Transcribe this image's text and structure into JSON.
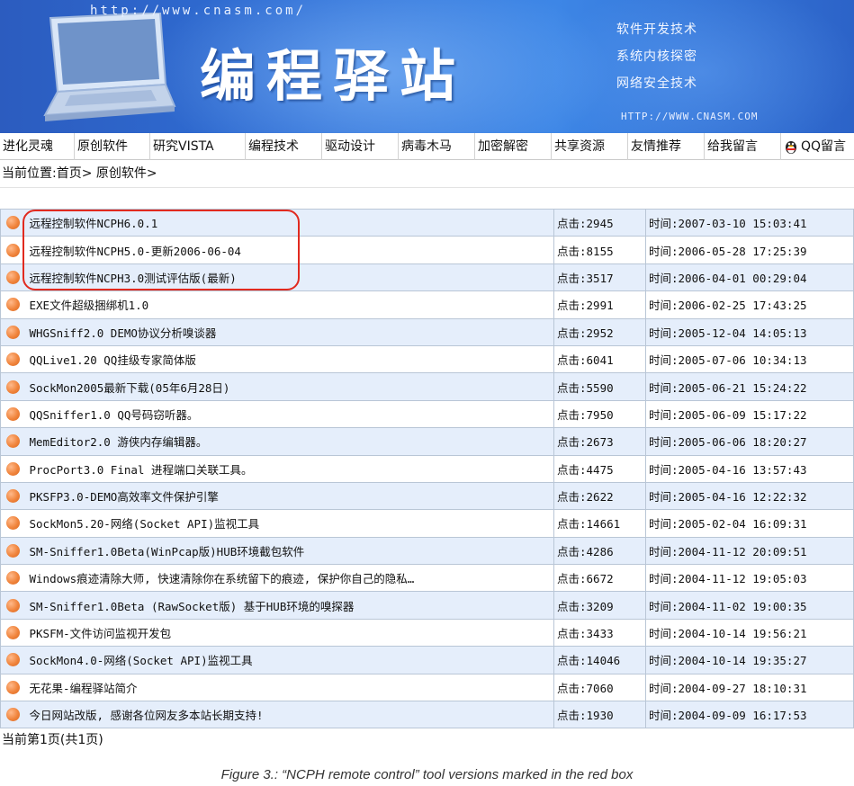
{
  "header": {
    "url": "http://www.cnasm.com/",
    "site_title": "编程驿站",
    "slogans": [
      "软件开发技术",
      "系统内核探密",
      "网络安全技术"
    ],
    "url_lower": "HTTP://WWW.CNASM.COM"
  },
  "nav": {
    "items": [
      {
        "label": "进化灵魂"
      },
      {
        "label": "原创软件"
      },
      {
        "label": "研究VISTA"
      },
      {
        "label": "编程技术"
      },
      {
        "label": "驱动设计"
      },
      {
        "label": "病毒木马"
      },
      {
        "label": "加密解密"
      },
      {
        "label": "共享资源"
      },
      {
        "label": "友情推荐"
      },
      {
        "label": "给我留言"
      },
      {
        "label": "QQ留言"
      }
    ]
  },
  "breadcrumb": {
    "prefix": "当前位置:",
    "home": "首页>",
    "current": "原创软件>"
  },
  "list": [
    {
      "title": "远程控制软件NCPH6.0.1",
      "clicks": "点击:2945",
      "time": "时间:2007-03-10 15:03:41"
    },
    {
      "title": "远程控制软件NCPH5.0-更新2006-06-04",
      "clicks": "点击:8155",
      "time": "时间:2006-05-28 17:25:39"
    },
    {
      "title": "远程控制软件NCPH3.0测试评估版(最新)",
      "clicks": "点击:3517",
      "time": "时间:2006-04-01 00:29:04"
    },
    {
      "title": "EXE文件超级捆绑机1.0",
      "clicks": "点击:2991",
      "time": "时间:2006-02-25 17:43:25"
    },
    {
      "title": "WHGSniff2.0 DEMO协议分析嗅谈器",
      "clicks": "点击:2952",
      "time": "时间:2005-12-04 14:05:13"
    },
    {
      "title": "QQLive1.20 QQ挂级专家简体版",
      "clicks": "点击:6041",
      "time": "时间:2005-07-06 10:34:13"
    },
    {
      "title": "SockMon2005最新下载(05年6月28日)",
      "clicks": "点击:5590",
      "time": "时间:2005-06-21 15:24:22"
    },
    {
      "title": "QQSniffer1.0 QQ号码窃听器。",
      "clicks": "点击:7950",
      "time": "时间:2005-06-09 15:17:22"
    },
    {
      "title": "MemEditor2.0 游侠内存编辑器。",
      "clicks": "点击:2673",
      "time": "时间:2005-06-06 18:20:27"
    },
    {
      "title": "ProcPort3.0 Final 进程端口关联工具。",
      "clicks": "点击:4475",
      "time": "时间:2005-04-16 13:57:43"
    },
    {
      "title": "PKSFP3.0-DEMO高效率文件保护引擎",
      "clicks": "点击:2622",
      "time": "时间:2005-04-16 12:22:32"
    },
    {
      "title": "SockMon5.20-网络(Socket API)监视工具",
      "clicks": "点击:14661",
      "time": "时间:2005-02-04 16:09:31"
    },
    {
      "title": "SM-Sniffer1.0Beta(WinPcap版)HUB环境截包软件",
      "clicks": "点击:4286",
      "time": "时间:2004-11-12 20:09:51"
    },
    {
      "title": "Windows痕迹清除大师, 快速清除你在系统留下的痕迹, 保护你自己的隐私…",
      "clicks": "点击:6672",
      "time": "时间:2004-11-12 19:05:03"
    },
    {
      "title": "SM-Sniffer1.0Beta (RawSocket版) 基于HUB环境的嗅探器",
      "clicks": "点击:3209",
      "time": "时间:2004-11-02 19:00:35"
    },
    {
      "title": "PKSFM-文件访问监视开发包",
      "clicks": "点击:3433",
      "time": "时间:2004-10-14 19:56:21"
    },
    {
      "title": "SockMon4.0-网络(Socket API)监视工具",
      "clicks": "点击:14046",
      "time": "时间:2004-10-14 19:35:27"
    },
    {
      "title": "无花果-编程驿站简介",
      "clicks": "点击:7060",
      "time": "时间:2004-09-27 18:10:31"
    },
    {
      "title": "今日网站改版, 感谢各位网友多本站长期支持!",
      "clicks": "点击:1930",
      "time": "时间:2004-09-09 16:17:53"
    }
  ],
  "pager": "当前第1页(共1页)",
  "caption": "Figure 3.: “NCPH remote control” tool versions marked in the red box",
  "colors": {
    "banner": "#2f6fd6",
    "row_alt": "#e5eefb",
    "annotation": "#e12a1f",
    "bullet": "#f0843c"
  }
}
